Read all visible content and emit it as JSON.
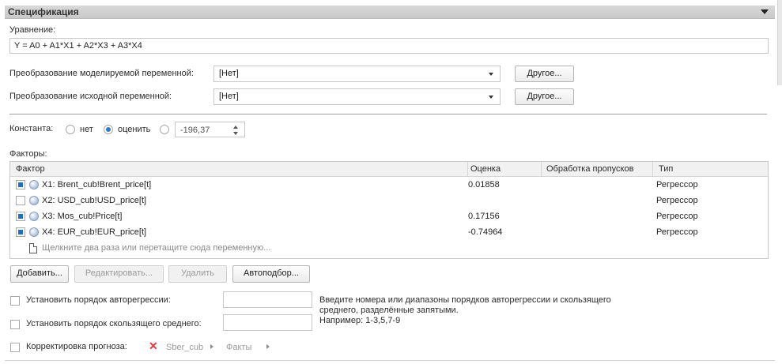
{
  "panel": {
    "title": "Спецификация"
  },
  "equation": {
    "label": "Уравнение:",
    "value": "Y = A0 + A1*X1 + A2*X3 + A3*X4"
  },
  "transform_model": {
    "label": "Преобразование моделируемой переменной:",
    "value": "[Нет]",
    "button": "Другое..."
  },
  "transform_source": {
    "label": "Преобразование исходной переменной:",
    "value": "[Нет]",
    "button": "Другое..."
  },
  "constant": {
    "label": "Константа:",
    "none": "нет",
    "estimate": "оценить",
    "selected": "estimate",
    "value": "-196,37"
  },
  "factors": {
    "label": "Факторы:",
    "columns": [
      "Фактор",
      "Оценка",
      "Обработка пропусков",
      "Тип"
    ],
    "rows": [
      {
        "checked": true,
        "name": "X1: Brent_cub!Brent_price[t]",
        "estimate": "0.01858",
        "missing": "",
        "type": "Регрессор"
      },
      {
        "checked": false,
        "name": "X2: USD_cub!USD_price[t]",
        "estimate": "",
        "missing": "",
        "type": "Регрессор"
      },
      {
        "checked": true,
        "name": "X3: Mos_cub!Price[t]",
        "estimate": "0.17156",
        "missing": "",
        "type": "Регрессор"
      },
      {
        "checked": true,
        "name": "X4: EUR_cub!EUR_price[t]",
        "estimate": "-0.74964",
        "missing": "",
        "type": "Регрессор"
      }
    ],
    "add_hint": "Щелкните два раза или перетащите сюда переменную..."
  },
  "buttons": {
    "add": "Добавить...",
    "edit": "Редактировать...",
    "delete": "Удалить",
    "autofit": "Автоподбор..."
  },
  "ar_order": {
    "label": "Установить порядок авторегрессии:",
    "value": ""
  },
  "ma_order": {
    "label": "Установить порядок скользящего среднего:",
    "value": ""
  },
  "order_note": {
    "line1": "Введите номера или диапазоны порядков авторегрессии и скользящего",
    "line2": "среднего, разделённые запятыми.",
    "line3": "Например: 1-3,5,7-9"
  },
  "forecast_correction": {
    "label": "Корректировка прогноза:",
    "icon": "close-icon",
    "crumb1": "Sber_cub",
    "crumb2": "Факты"
  }
}
